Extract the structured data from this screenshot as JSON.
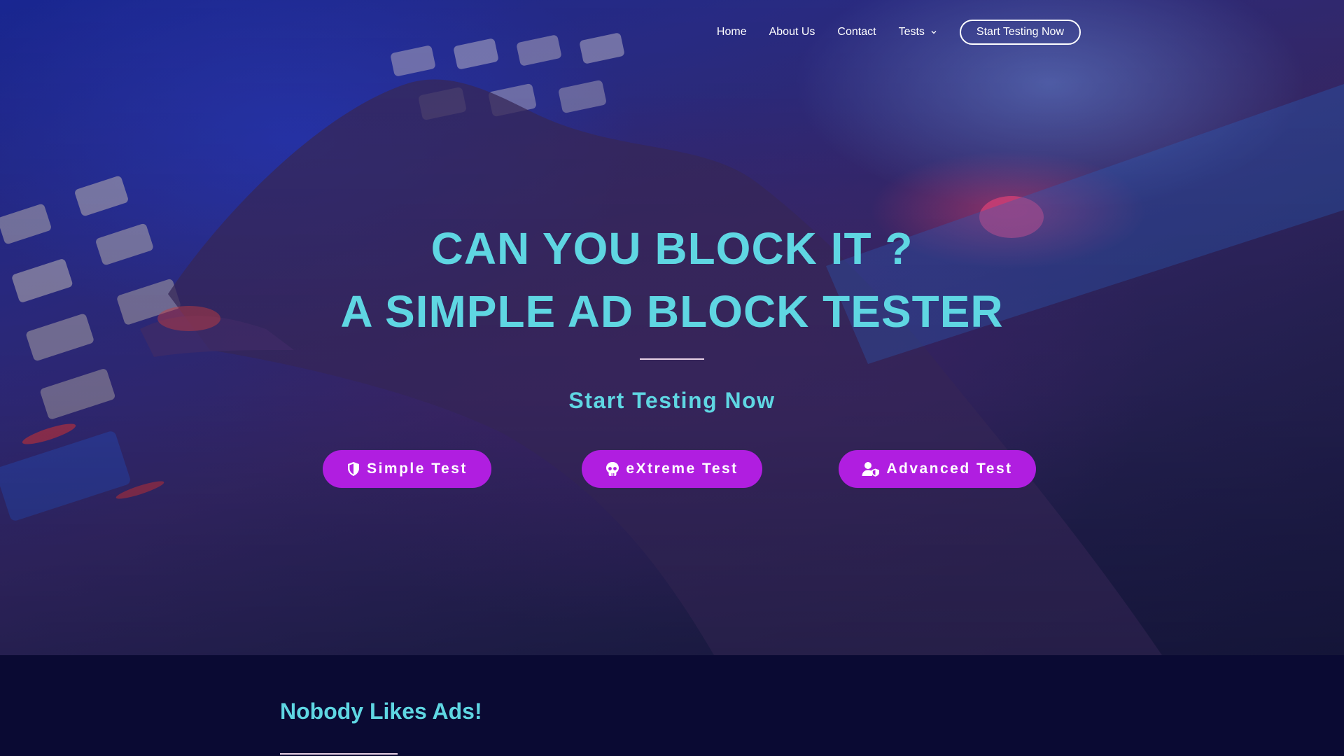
{
  "nav": {
    "items": [
      {
        "label": "Home"
      },
      {
        "label": "About Us"
      },
      {
        "label": "Contact"
      },
      {
        "label": "Tests",
        "icon": "chevron-down-icon"
      }
    ],
    "cta_label": "Start Testing Now"
  },
  "hero": {
    "title_line1": "CAN YOU BLOCK IT ?",
    "title_line2": "A SIMPLE AD BLOCK TESTER",
    "subtitle": "Start Testing Now",
    "buttons": [
      {
        "label": "Simple Test",
        "icon": "shield-icon"
      },
      {
        "label": "eXtreme Test",
        "icon": "skull-icon"
      },
      {
        "label": "Advanced Test",
        "icon": "user-shield-icon"
      }
    ]
  },
  "section": {
    "title": "Nobody Likes Ads!"
  },
  "colors": {
    "accent_cyan": "#5fd6e2",
    "button_purple": "#b01ee0",
    "section_bg": "#0a0a33"
  }
}
